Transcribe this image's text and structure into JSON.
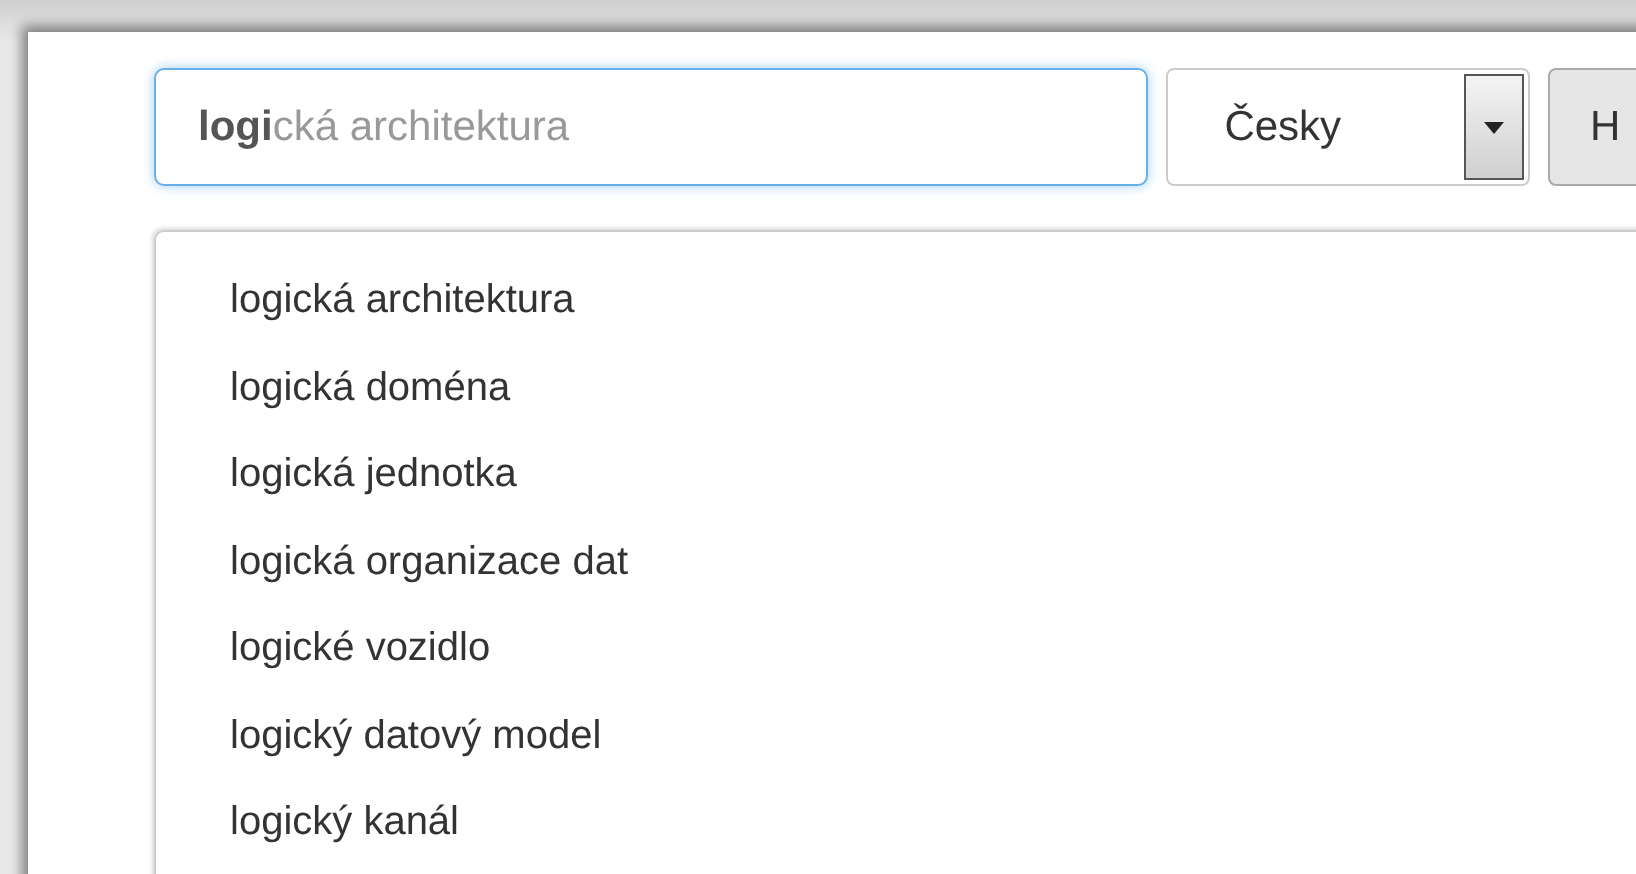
{
  "search": {
    "value": "logi",
    "completion": "cká architektura"
  },
  "language_select": {
    "value": "Česky"
  },
  "button": {
    "label": "H"
  },
  "suggestions": [
    {
      "text": "logická architektura"
    },
    {
      "text": "logická doména"
    },
    {
      "text": "logická jednotka"
    },
    {
      "text": "logická organizace dat"
    },
    {
      "text": "logické vozidlo"
    },
    {
      "text": "logický datový model"
    },
    {
      "text": "logický kanál"
    }
  ]
}
